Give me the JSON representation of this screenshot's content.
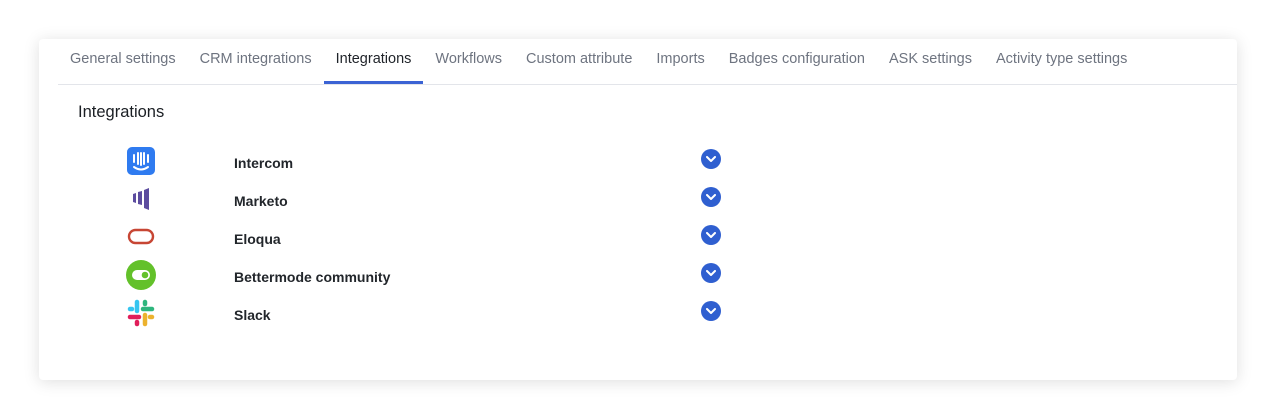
{
  "tabs": [
    {
      "label": "General settings"
    },
    {
      "label": "CRM integrations"
    },
    {
      "label": "Integrations",
      "active": true
    },
    {
      "label": "Workflows"
    },
    {
      "label": "Custom attribute"
    },
    {
      "label": "Imports"
    },
    {
      "label": "Badges configuration"
    },
    {
      "label": "ASK settings"
    },
    {
      "label": "Activity type settings"
    }
  ],
  "section": {
    "title": "Integrations"
  },
  "integrations": [
    {
      "name": "Intercom",
      "icon": "intercom-logo-icon"
    },
    {
      "name": "Marketo",
      "icon": "marketo-logo-icon"
    },
    {
      "name": "Eloqua",
      "icon": "eloqua-logo-icon"
    },
    {
      "name": "Bettermode community",
      "icon": "bettermode-logo-icon"
    },
    {
      "name": "Slack",
      "icon": "slack-logo-icon"
    }
  ],
  "colors": {
    "accent": "#3b63d4",
    "expand_button": "#2f5fd0"
  }
}
